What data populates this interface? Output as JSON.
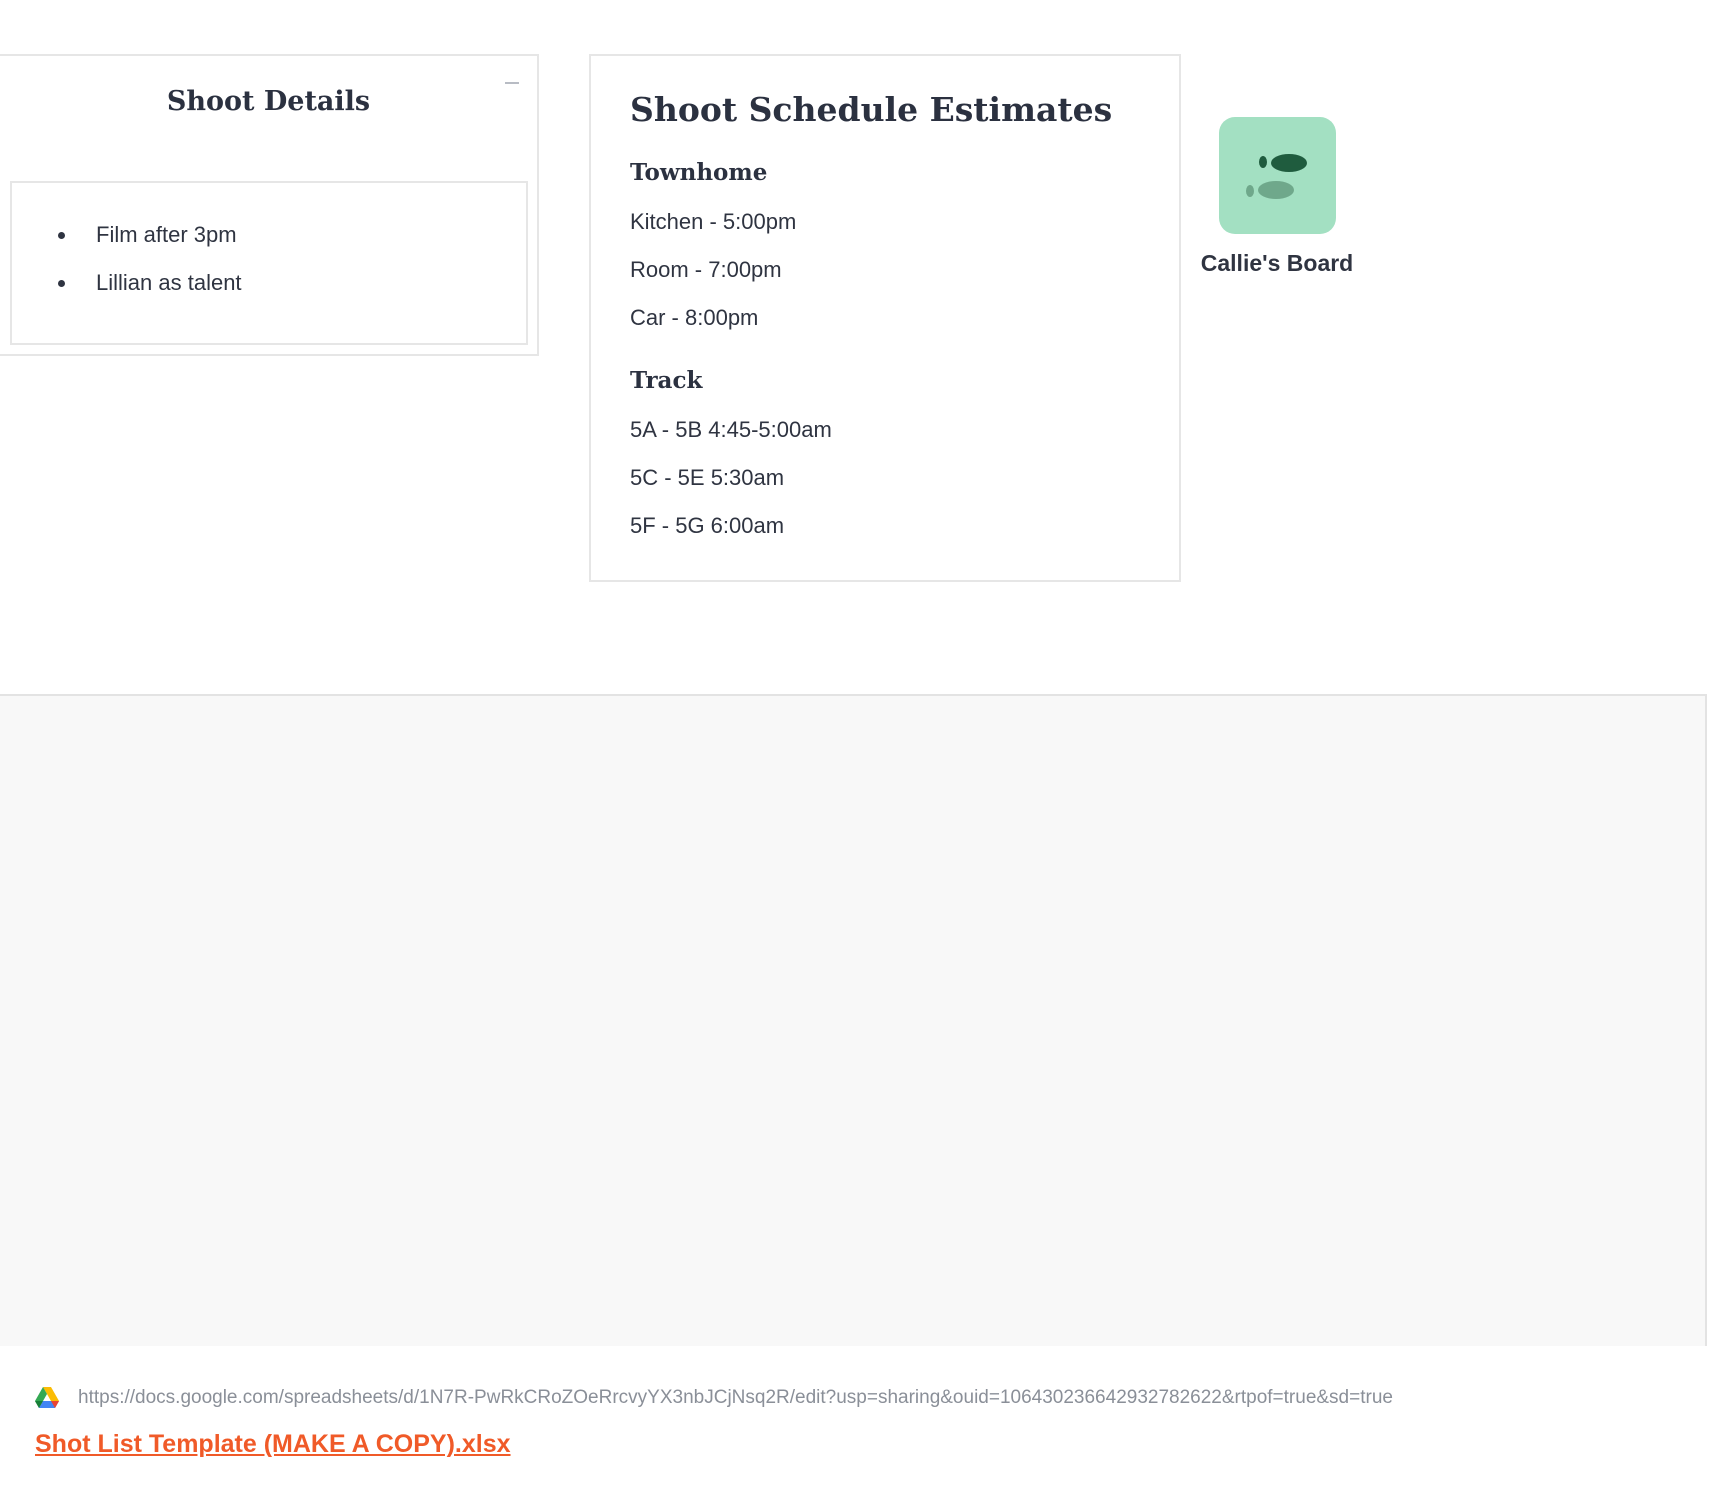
{
  "shoot_details": {
    "title": "Shoot Details",
    "items": [
      "Film after 3pm",
      "Lillian as talent"
    ]
  },
  "schedule": {
    "title": "Shoot Schedule Estimates",
    "sections": [
      {
        "heading": "Townhome",
        "lines": [
          "Kitchen - 5:00pm",
          "Room - 7:00pm",
          "Car - 8:00pm"
        ]
      },
      {
        "heading": "Track",
        "lines": [
          "5A - 5B 4:45-5:00am",
          "5C - 5E 5:30am",
          "5F - 5G 6:00am"
        ]
      }
    ]
  },
  "board": {
    "label": "Callie's Board",
    "icon": "footprints-icon",
    "icon_bg": "#a3e0c2",
    "icon_fg_dark": "#1f5c3e",
    "icon_fg_light": "#6fa88b"
  },
  "embed": {
    "source_icon": "google-drive-icon",
    "url": "https://docs.google.com/spreadsheets/d/1N7R-PwRkCRoZOeRrcvyYX3nbJCjNsq2R/edit?usp=sharing&ouid=106430236642932782622&rtpof=true&sd=true",
    "link_text": "Shot List Template (MAKE A COPY).xlsx",
    "link_color": "#f05a28"
  }
}
